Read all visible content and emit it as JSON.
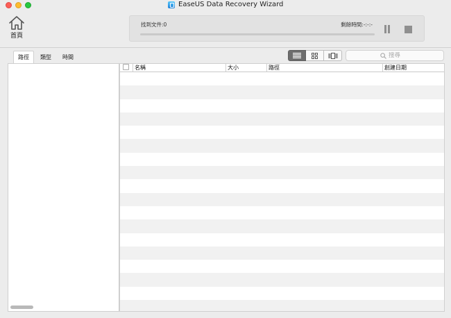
{
  "window": {
    "title": "EaseUS Data Recovery Wizard"
  },
  "toolbar": {
    "home_label": "首頁",
    "found_files": "找到文件:0",
    "remaining_time": "剩餘時間:-:-:-"
  },
  "tabs": [
    {
      "label": "路徑",
      "active": true
    },
    {
      "label": "類型",
      "active": false
    },
    {
      "label": "時間",
      "active": false
    }
  ],
  "view_modes": [
    "list-view-icon",
    "grid-view-icon",
    "cover-flow-icon"
  ],
  "search": {
    "placeholder": "搜尋"
  },
  "table": {
    "columns": [
      "名稱",
      "大小",
      "路徑",
      "創建日期"
    ],
    "rows": []
  },
  "colors": {
    "stripe": "#f1f1f1",
    "active_view": "#6d6d6d"
  }
}
